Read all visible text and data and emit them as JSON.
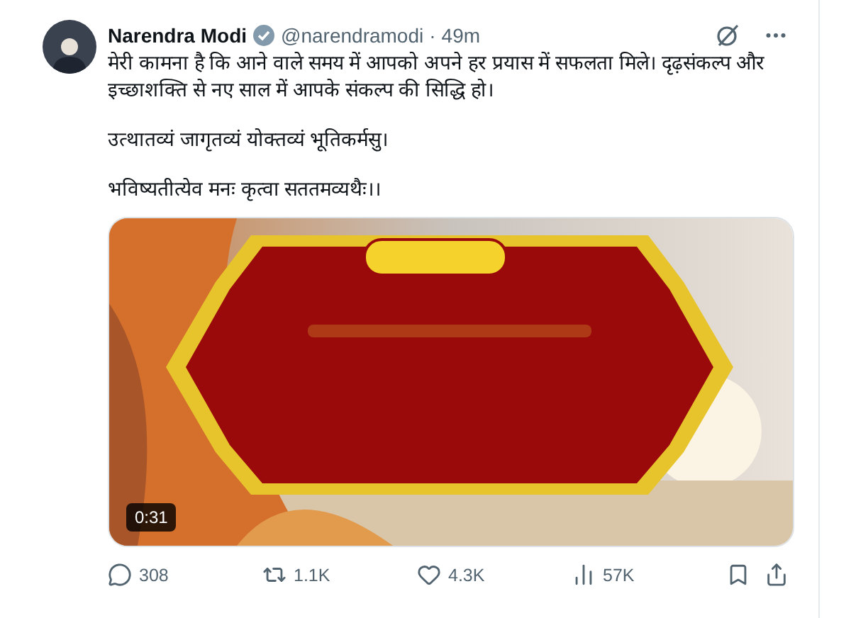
{
  "post": {
    "author": "Narendra Modi",
    "verified": true,
    "handle": "@narendramodi",
    "separator": "·",
    "time": "49m",
    "paragraphs": [
      "मेरी कामना है कि आने वाले समय में आपको अपने हर प्रयास में सफलता मिले। दृढ़संकल्प और इच्छाशक्ति से नए साल में आपके संकल्प की सिद्धि हो।",
      "उत्थातव्यं जागृतव्यं योक्तव्यं भूतिकर्मसु।",
      "भविष्यतीत्येव मनः कृत्वा सततमव्यथैः।।"
    ],
    "media": {
      "kind": "picture",
      "duration": "0:31"
    },
    "actions": [
      {
        "kind": "reply",
        "count": "308"
      },
      {
        "kind": "repost",
        "count": "1.1K"
      },
      {
        "kind": "like",
        "count": "4.3K"
      },
      {
        "kind": "views",
        "count": "57K"
      }
    ]
  }
}
